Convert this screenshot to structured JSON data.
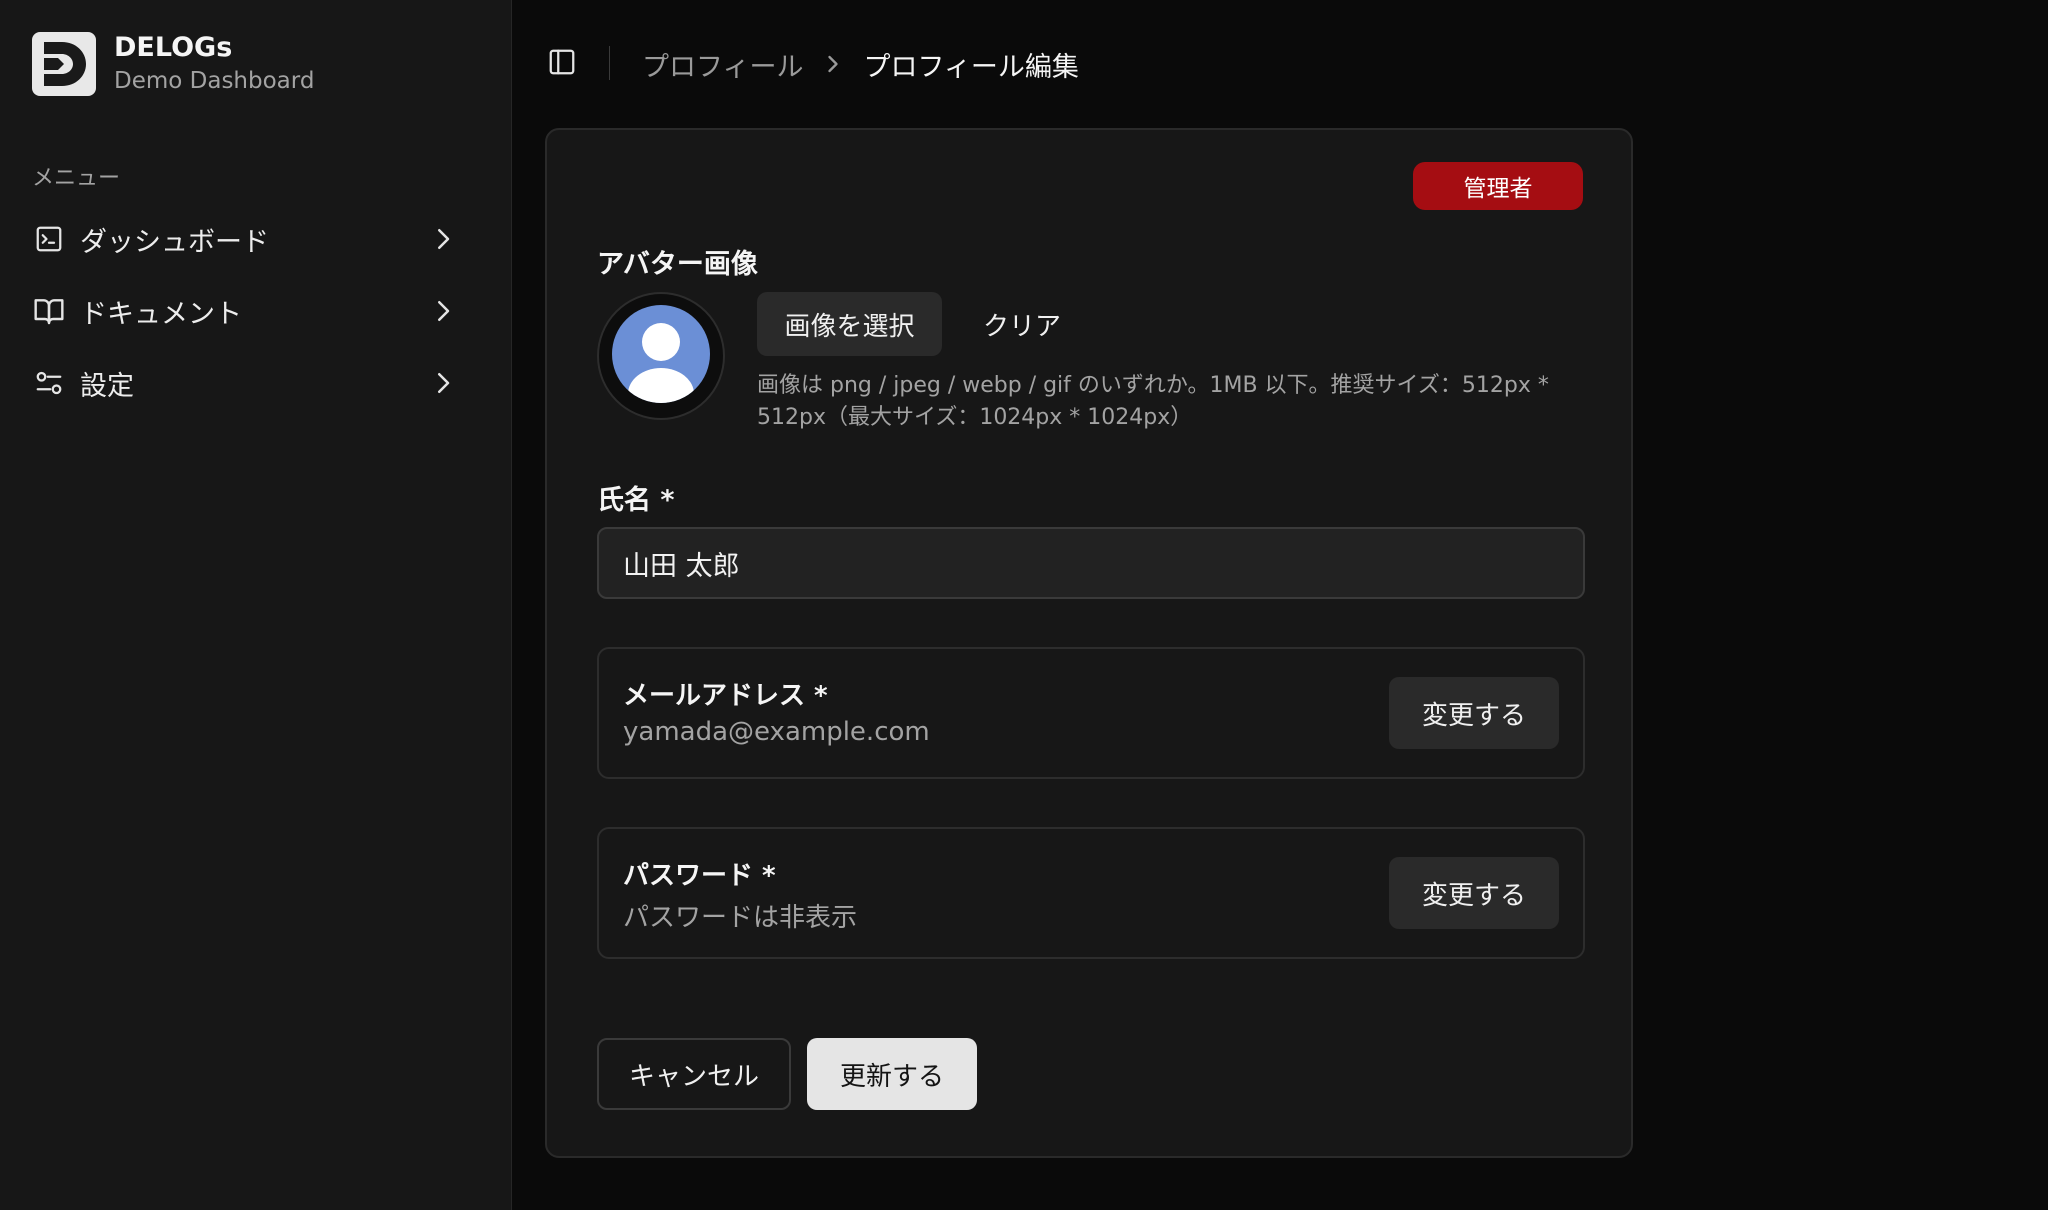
{
  "brand": {
    "name": "DELOGs",
    "subtitle": "Demo Dashboard",
    "logo_icon": "delogs-logo-icon"
  },
  "sidebar": {
    "menu_label": "メニュー",
    "items": [
      {
        "label": "ダッシュボード",
        "icon": "terminal-square-icon"
      },
      {
        "label": "ドキュメント",
        "icon": "book-open-icon"
      },
      {
        "label": "設定",
        "icon": "settings-sliders-icon"
      }
    ]
  },
  "header": {
    "breadcrumb": {
      "parent": "プロフィール",
      "current": "プロフィール編集"
    }
  },
  "profile": {
    "role_badge": "管理者",
    "avatar": {
      "label": "アバター画像",
      "select_button": "画像を選択",
      "clear_button": "クリア",
      "hint": "画像は png / jpeg / webp / gif のいずれか。1MB 以下。推奨サイズ：512px * 512px（最大サイズ：1024px * 1024px）"
    },
    "name": {
      "label": "氏名 *",
      "value": "山田 太郎"
    },
    "email": {
      "label": "メールアドレス *",
      "value": "yamada@example.com",
      "change_button": "変更する"
    },
    "password": {
      "label": "パスワード *",
      "value": "パスワードは非表示",
      "change_button": "変更する"
    },
    "actions": {
      "cancel": "キャンセル",
      "submit": "更新する"
    }
  },
  "colors": {
    "background": "#0a0a0a",
    "sidebar": "#171717",
    "card": "#171717",
    "badge": "#a50d12",
    "avatar_blue": "#6b8fd6",
    "primary_button": "#e5e5e5"
  }
}
